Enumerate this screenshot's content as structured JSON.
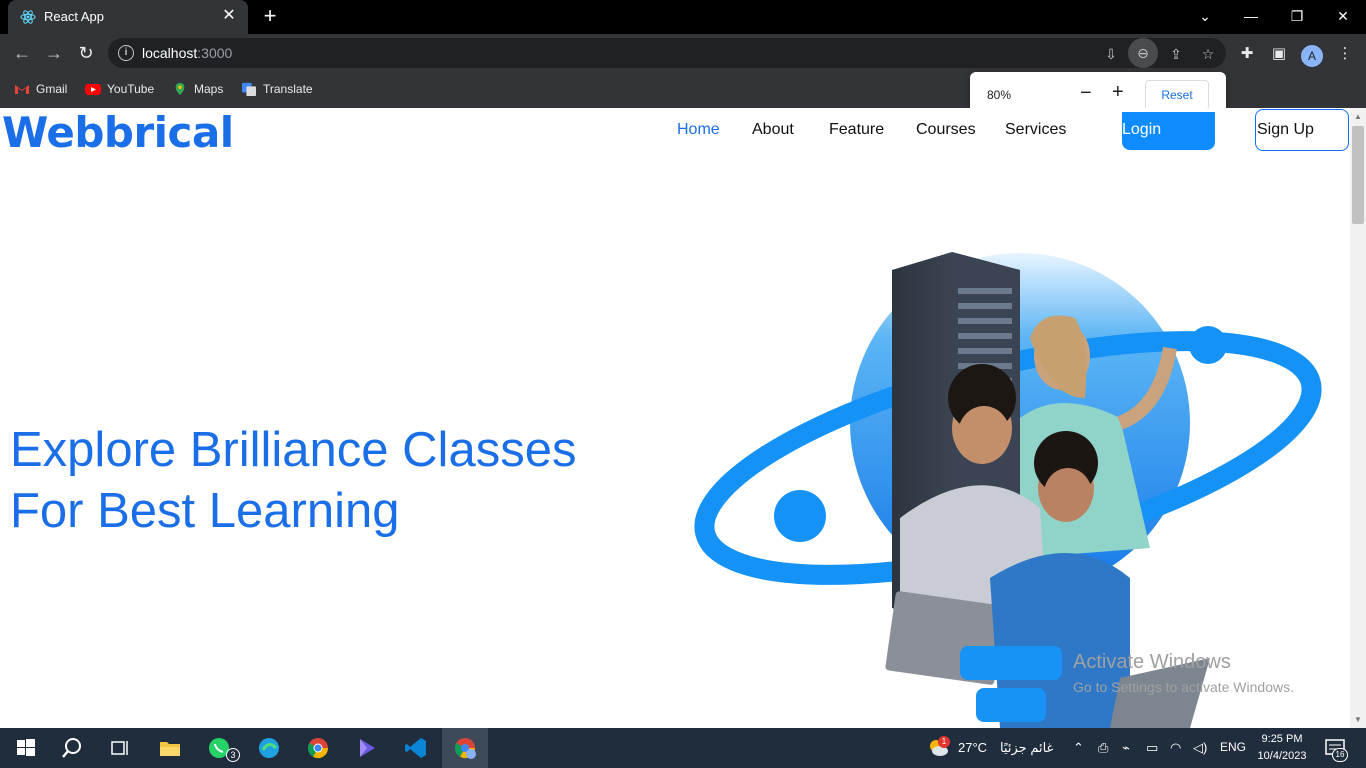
{
  "browser": {
    "tab_title": "React App",
    "url_host": "localhost",
    "url_port": ":3000",
    "bookmarks": [
      "Gmail",
      "YouTube",
      "Maps",
      "Translate"
    ],
    "zoom": {
      "percent": "80%",
      "reset_label": "Reset"
    },
    "profile_initial": "A"
  },
  "site": {
    "logo": "Webbrical",
    "nav": [
      "Home",
      "About",
      "Feature",
      "Courses",
      "Services"
    ],
    "login_label": "Login",
    "signup_label": "Sign Up",
    "hero_line1": "Explore Brilliance Classes",
    "hero_line2": "For Best Learning"
  },
  "watermark": {
    "title": "Activate Windows",
    "subtitle": "Go to Settings to activate Windows."
  },
  "taskbar": {
    "whatsapp_badge": "3",
    "weather_badge": "1",
    "temperature": "27°C",
    "weather_text": "غائم جزئيًا",
    "language": "ENG",
    "time": "9:25 PM",
    "date": "10/4/2023",
    "notifications": "16"
  },
  "colors": {
    "brand": "#1a6ee8",
    "accent": "#0d8bff",
    "chrome": "#333438"
  }
}
